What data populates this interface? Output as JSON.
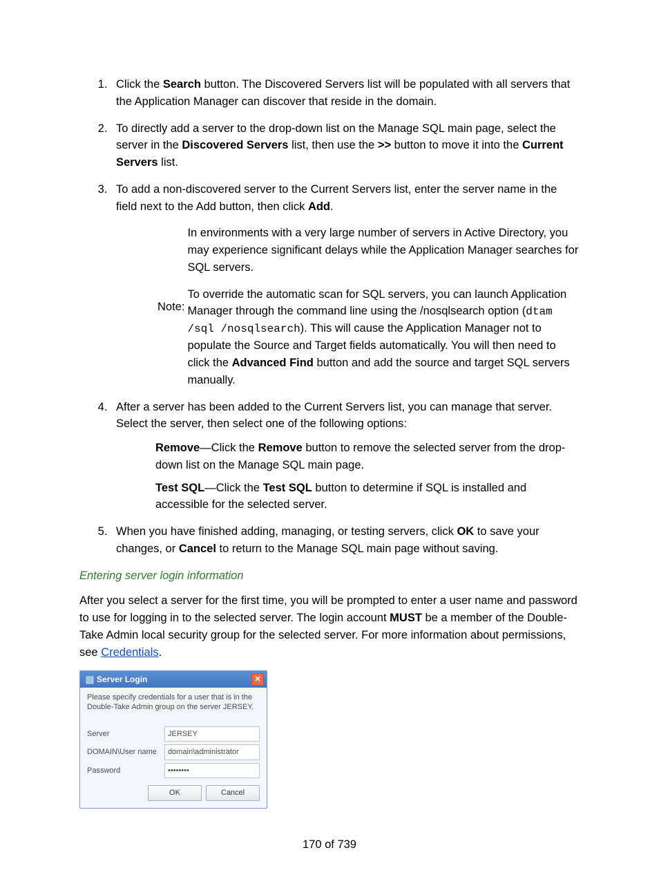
{
  "steps": {
    "s1": {
      "pre": "Click the ",
      "b1": "Search",
      "post": " button. The Discovered Servers list will be populated with all servers that the Application Manager can discover that reside in the domain."
    },
    "s2": {
      "pre": "To directly add a server to the drop-down list on the Manage SQL main page, select the server in the ",
      "b1": "Discovered Servers",
      "mid1": " list, then use the ",
      "b2": ">>",
      "mid2": " button to move it into the ",
      "b3": "Current Servers",
      "post": " list."
    },
    "s3": {
      "pre": "To add a non-discovered server to the Current Servers list, enter the server name in the field next to the Add button, then click ",
      "b1": "Add",
      "post": "."
    },
    "note": {
      "label": "Note:",
      "p1": "In environments with a very large number of servers in Active Directory, you may experience significant delays while the Application Manager searches for SQL servers.",
      "p2_pre": "To override the automatic scan for SQL servers, you can launch Application Manager through the command line using the /nosqlsearch option (",
      "p2_code": "dtam /sql /nosqlsearch",
      "p2_mid": "). This will cause the Application Manager not to populate the Source and Target fields automatically. You will then need to click the ",
      "p2_b": "Advanced Find",
      "p2_post": " button and add the source and target SQL servers manually."
    },
    "s4": {
      "main": "After a server has been added to the Current Servers list, you can manage that server. Select the server, then select one of the following options:",
      "remove_b1": "Remove",
      "remove_mid": "—Click the ",
      "remove_b2": "Remove",
      "remove_post": " button to remove the selected server from the drop-down list on the Manage SQL main page.",
      "test_b1": "Test SQL",
      "test_mid": "—Click the ",
      "test_b2": "Test SQL",
      "test_post": " button to determine if SQL is installed and accessible for the selected server."
    },
    "s5": {
      "pre": "When you have finished adding, managing, or testing servers, click ",
      "b1": "OK",
      "mid": " to save your changes, or ",
      "b2": "Cancel",
      "post": " to return to the Manage SQL main page without saving."
    }
  },
  "section": {
    "heading": "Entering server login information",
    "para_pre": "After you select a server for the first time, you will be prompted to enter a user name and password to use for logging in to the selected server. The login account ",
    "para_b": "MUST",
    "para_mid": " be a member of the Double-Take Admin local security group for the selected server. For more information about permissions, see ",
    "link": "Credentials",
    "para_post": "."
  },
  "dialog": {
    "title": "Server Login",
    "close": "✕",
    "desc": "Please specify credentials for a user that is in the Double-Take Admin group on the server JERSEY.",
    "labels": {
      "server": "Server",
      "user": "DOMAIN\\User name",
      "password": "Password"
    },
    "values": {
      "server": "JERSEY",
      "user": "domain\\administrator",
      "password": "••••••••"
    },
    "ok": "OK",
    "cancel": "Cancel"
  },
  "footer": "170 of 739"
}
